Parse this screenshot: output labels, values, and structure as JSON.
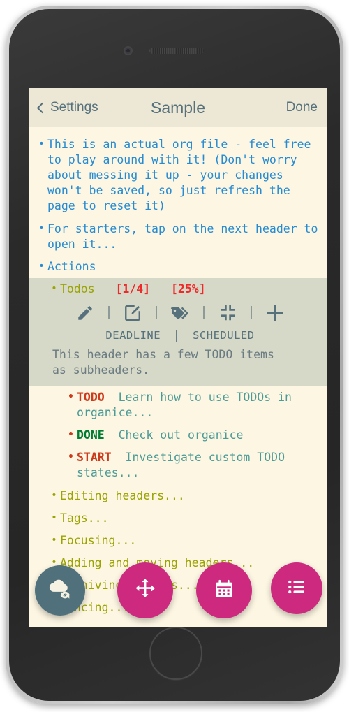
{
  "navbar": {
    "back_label": "Settings",
    "back_icon": "chevron-left-icon",
    "title": "Sample",
    "done_label": "Done"
  },
  "content": {
    "items": [
      {
        "id": "intro",
        "level": 1,
        "bullet": "•",
        "bullet_color": "#268bd2",
        "color": "#268bd2",
        "text": "This is an actual org file - feel free to play around with it! (Don't worry about messing it up - your changes won't be saved, so just refresh the page to reset it)"
      },
      {
        "id": "starters",
        "level": 1,
        "bullet": "•",
        "bullet_color": "#268bd2",
        "color": "#268bd2",
        "text": "For starters, tap on the next header to open it..."
      },
      {
        "id": "actions",
        "level": 1,
        "bullet": "•",
        "bullet_color": "#268bd2",
        "color": "#268bd2",
        "text": "Actions"
      }
    ],
    "selected_header": {
      "id": "todos",
      "bullet": "•",
      "title": "Todos",
      "cookie_count": "[1/4]",
      "cookie_percent": "[25%]",
      "title_color": "#9aa300",
      "cookie_color": "#ef2929",
      "background": "#d6d9c8",
      "description": "This header has a few TODO items\nas subheaders.",
      "toolbar": {
        "buttons": [
          {
            "name": "edit-title-icon",
            "label": "pencil"
          },
          {
            "name": "edit-description-icon",
            "label": "edit-square"
          },
          {
            "name": "tags-icon",
            "label": "tag"
          },
          {
            "name": "collapse-icon",
            "label": "compress"
          },
          {
            "name": "add-icon",
            "label": "plus"
          }
        ],
        "separator": "|"
      },
      "date_row": {
        "deadline_label": "DEADLINE",
        "separator": "|",
        "scheduled_label": "SCHEDULED"
      }
    },
    "todo_items": [
      {
        "id": "todo-1",
        "keyword": "TODO",
        "keyword_color": "#cc3b1b",
        "text": "Learn how to use TODOs in organice...",
        "text_color": "#4c9b96"
      },
      {
        "id": "todo-2",
        "keyword": "DONE",
        "keyword_color": "#007d32",
        "text": "Check out organice",
        "text_color": "#4c9b96"
      },
      {
        "id": "todo-3",
        "keyword": "START",
        "keyword_color": "#cc3b1b",
        "text": "Investigate custom TODO states...",
        "text_color": "#4c9b96"
      }
    ],
    "tail_items": [
      {
        "id": "editing-headers",
        "bullet": "•",
        "text": "Editing headers...",
        "color": "#9aa300"
      },
      {
        "id": "tags",
        "bullet": "•",
        "text": "Tags...",
        "color": "#9aa300"
      },
      {
        "id": "focusing",
        "bullet": "•",
        "text": "Focusing...",
        "color": "#9aa300"
      },
      {
        "id": "adding-moving",
        "bullet": "•",
        "text": "Adding and moving headers...",
        "color": "#9aa300"
      },
      {
        "id": "archiving",
        "bullet": "•",
        "text": "Archiving headers...",
        "color": "#9aa300"
      },
      {
        "id": "syncing",
        "bullet": "•",
        "text": "Syncing...",
        "color": "#9aa300"
      }
    ]
  },
  "fabs": [
    {
      "id": "sync",
      "icon": "cloud-sync-icon",
      "color": "#50707c"
    },
    {
      "id": "move",
      "icon": "arrows-move-icon",
      "color": "#cd2a7f"
    },
    {
      "id": "calendar",
      "icon": "calendar-icon",
      "color": "#cd2a7f"
    },
    {
      "id": "list",
      "icon": "list-icon",
      "color": "#cd2a7f"
    }
  ],
  "theme": {
    "screen_background": "#fdf6e3",
    "navbar_background": "#ece8d5",
    "navbar_text": "#56707c",
    "selection_background": "#d6d9c8"
  }
}
